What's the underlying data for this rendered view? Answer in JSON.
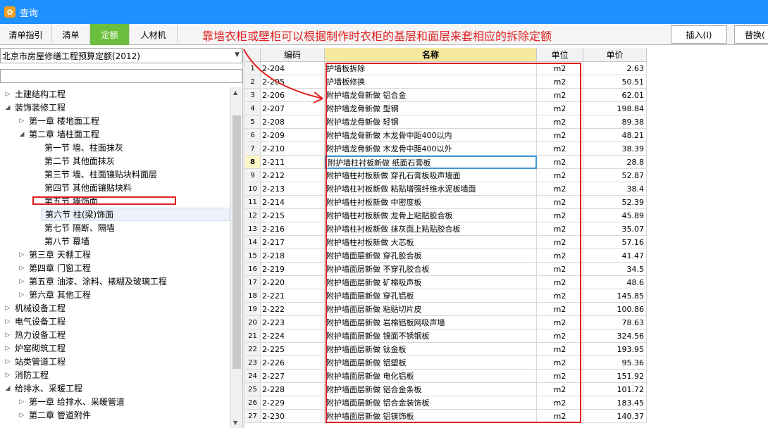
{
  "window": {
    "title": "查询",
    "icon": "app-icon"
  },
  "tabs": [
    {
      "label": "清单指引",
      "active": false
    },
    {
      "label": "清单",
      "active": false
    },
    {
      "label": "定额",
      "active": true
    },
    {
      "label": "人材机",
      "active": false
    }
  ],
  "annotation": "靠墙衣柜或壁柜可以根据制作时衣柜的基层和面层来套相应的拆除定额",
  "buttons": {
    "insert": "插入(I)",
    "replace": "替换("
  },
  "quota_library": {
    "selected": "北京市房屋修缮工程预算定额(2012)"
  },
  "tree": [
    {
      "label": "土建结构工程",
      "level": 0,
      "state": "collapsed"
    },
    {
      "label": "装饰装修工程",
      "level": 0,
      "state": "expanded"
    },
    {
      "label": "第一章 楼地面工程",
      "level": 1,
      "state": "collapsed"
    },
    {
      "label": "第二章 墙柱面工程",
      "level": 1,
      "state": "expanded"
    },
    {
      "label": "第一节 墙、柱面抹灰",
      "level": 2,
      "state": "leaf"
    },
    {
      "label": "第二节 其他面抹灰",
      "level": 2,
      "state": "leaf"
    },
    {
      "label": "第三节 墙、柱面镶贴块料面层",
      "level": 2,
      "state": "leaf"
    },
    {
      "label": "第四节 其他面镶贴块料",
      "level": 2,
      "state": "leaf"
    },
    {
      "label": "第五节 墙饰面",
      "level": 2,
      "state": "leaf"
    },
    {
      "label": "第六节 柱(梁)饰面",
      "level": 2,
      "state": "leaf",
      "selected": true
    },
    {
      "label": "第七节 隔断、隔墙",
      "level": 2,
      "state": "leaf"
    },
    {
      "label": "第八节 幕墙",
      "level": 2,
      "state": "leaf"
    },
    {
      "label": "第三章 天棚工程",
      "level": 1,
      "state": "collapsed"
    },
    {
      "label": "第四章 门窗工程",
      "level": 1,
      "state": "collapsed"
    },
    {
      "label": "第五章 油漆、涂料、裱糊及玻璃工程",
      "level": 1,
      "state": "collapsed"
    },
    {
      "label": "第六章 其他工程",
      "level": 1,
      "state": "collapsed"
    },
    {
      "label": "机械设备工程",
      "level": 0,
      "state": "collapsed"
    },
    {
      "label": "电气设备工程",
      "level": 0,
      "state": "collapsed"
    },
    {
      "label": "热力设备工程",
      "level": 0,
      "state": "collapsed"
    },
    {
      "label": "炉窑砌筑工程",
      "level": 0,
      "state": "collapsed"
    },
    {
      "label": "站类管道工程",
      "level": 0,
      "state": "collapsed"
    },
    {
      "label": "消防工程",
      "level": 0,
      "state": "collapsed"
    },
    {
      "label": "给排水、采暖工程",
      "level": 0,
      "state": "expanded"
    },
    {
      "label": "第一章 给排水、采暖管道",
      "level": 1,
      "state": "collapsed"
    },
    {
      "label": "第二章 管道附件",
      "level": 1,
      "state": "collapsed"
    }
  ],
  "table": {
    "columns": [
      "编码",
      "名称",
      "单位",
      "单价"
    ],
    "current_row": 8,
    "rows": [
      {
        "no": "1",
        "code": "2-204",
        "name": "护墙板拆除",
        "unit": "m2",
        "price": "2.63"
      },
      {
        "no": "2",
        "code": "2-205",
        "name": "护墙板修换",
        "unit": "m2",
        "price": "50.51"
      },
      {
        "no": "3",
        "code": "2-206",
        "name": "附护墙龙骨新做 铝合金",
        "unit": "m2",
        "price": "62.01"
      },
      {
        "no": "4",
        "code": "2-207",
        "name": "附护墙龙骨新做 型钢",
        "unit": "m2",
        "price": "198.84"
      },
      {
        "no": "5",
        "code": "2-208",
        "name": "附护墙龙骨新做 轻钢",
        "unit": "m2",
        "price": "89.38"
      },
      {
        "no": "6",
        "code": "2-209",
        "name": "附护墙龙骨新做 木龙骨中距400以内",
        "unit": "m2",
        "price": "48.21"
      },
      {
        "no": "7",
        "code": "2-210",
        "name": "附护墙龙骨新做 木龙骨中距400以外",
        "unit": "m2",
        "price": "38.39"
      },
      {
        "no": "8",
        "code": "2-211",
        "name": "附护墙柱衬板新做 纸面石膏板",
        "unit": "m2",
        "price": "28.8"
      },
      {
        "no": "9",
        "code": "2-212",
        "name": "附护墙柱衬板新做 穿孔石膏板吸声墙面",
        "unit": "m2",
        "price": "52.87"
      },
      {
        "no": "10",
        "code": "2-213",
        "name": "附护墙柱衬板新做 粘贴增强纤维水泥板墙面",
        "unit": "m2",
        "price": "38.4"
      },
      {
        "no": "11",
        "code": "2-214",
        "name": "附护墙柱衬板新做 中密度板",
        "unit": "m2",
        "price": "52.39"
      },
      {
        "no": "12",
        "code": "2-215",
        "name": "附护墙柱衬板新做 龙骨上粘贴胶合板",
        "unit": "m2",
        "price": "45.89"
      },
      {
        "no": "13",
        "code": "2-216",
        "name": "附护墙柱衬板新做 抹灰面上粘贴胶合板",
        "unit": "m2",
        "price": "35.07"
      },
      {
        "no": "14",
        "code": "2-217",
        "name": "附护墙柱衬板新做 大芯板",
        "unit": "m2",
        "price": "57.16"
      },
      {
        "no": "15",
        "code": "2-218",
        "name": "附护墙面层新做 穿孔胶合板",
        "unit": "m2",
        "price": "41.47"
      },
      {
        "no": "16",
        "code": "2-219",
        "name": "附护墙面层新做 不穿孔胶合板",
        "unit": "m2",
        "price": "34.5"
      },
      {
        "no": "17",
        "code": "2-220",
        "name": "附护墙面层新做 矿棉吸声板",
        "unit": "m2",
        "price": "48.6"
      },
      {
        "no": "18",
        "code": "2-221",
        "name": "附护墙面层新做 穿孔铝板",
        "unit": "m2",
        "price": "145.85"
      },
      {
        "no": "19",
        "code": "2-222",
        "name": "附护墙面层新做 粘贴切片皮",
        "unit": "m2",
        "price": "100.86"
      },
      {
        "no": "20",
        "code": "2-223",
        "name": "附护墙面层新做 岩棉铝板网吸声墙",
        "unit": "m2",
        "price": "78.63"
      },
      {
        "no": "21",
        "code": "2-224",
        "name": "附护墙面层新做 镜面不锈钢板",
        "unit": "m2",
        "price": "324.56"
      },
      {
        "no": "22",
        "code": "2-225",
        "name": "附护墙面层新做 钛金板",
        "unit": "m2",
        "price": "193.95"
      },
      {
        "no": "23",
        "code": "2-226",
        "name": "附护墙面层新做 铝塑板",
        "unit": "m2",
        "price": "95.36"
      },
      {
        "no": "24",
        "code": "2-227",
        "name": "附护墙面层新做 电化铝板",
        "unit": "m2",
        "price": "151.92"
      },
      {
        "no": "25",
        "code": "2-228",
        "name": "附护墙面层新做 铝合金条板",
        "unit": "m2",
        "price": "101.72"
      },
      {
        "no": "26",
        "code": "2-229",
        "name": "附护墙面层新做 铝合金装饰板",
        "unit": "m2",
        "price": "183.45"
      },
      {
        "no": "27",
        "code": "2-230",
        "name": "附护墙面层新做 铝镁饰板",
        "unit": "m2",
        "price": "140.37"
      }
    ]
  },
  "colors": {
    "titlebar": "#1e90ff",
    "active_tab": "#6cbf3c",
    "annotation": "#e02020",
    "name_header": "#f7e8a0",
    "current_cell": "#3a9ad9"
  }
}
